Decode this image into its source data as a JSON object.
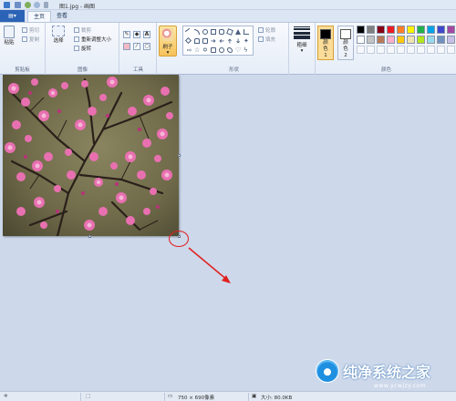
{
  "window": {
    "title": "图1.jpg - 画图"
  },
  "tabs": {
    "file": "▤▾",
    "home": "主页",
    "view": "查看"
  },
  "ribbon": {
    "clipboard": {
      "paste": "粘贴",
      "cut": "剪切",
      "copy": "复制",
      "group": "剪贴板"
    },
    "image": {
      "select": "选择",
      "crop": "裁剪",
      "resize": "重新调整大小",
      "rotate": "旋转",
      "group": "图像"
    },
    "tools": {
      "group": "工具",
      "text_tool": "A"
    },
    "brush": {
      "label": "刷子"
    },
    "shapes": {
      "outline": "轮廓",
      "fill": "填充",
      "group": "形状"
    },
    "size": {
      "label": "粗细"
    },
    "colors": {
      "color1": "颜色 1",
      "color2": "颜色 2",
      "group": "颜色",
      "color1_hex": "#000000",
      "color2_hex": "#ffffff",
      "palette_row1": [
        "#000000",
        "#7f7f7f",
        "#880015",
        "#ed1c24",
        "#ff7f27",
        "#fff200",
        "#22b14c",
        "#00a2e8",
        "#3f48cc",
        "#a349a4"
      ],
      "palette_row2": [
        "#ffffff",
        "#c3c3c3",
        "#b97a57",
        "#ffaec9",
        "#ffc90e",
        "#efe4b0",
        "#b5e61d",
        "#99d9ea",
        "#7092be",
        "#c8bfe7"
      ]
    }
  },
  "status": {
    "dimensions": "750 × 690像素",
    "size": "大小: 80.0KB"
  },
  "watermark": {
    "text": "纯净系统之家",
    "url": "www.ycwjzy.com"
  },
  "annotation_color": "#e02020"
}
